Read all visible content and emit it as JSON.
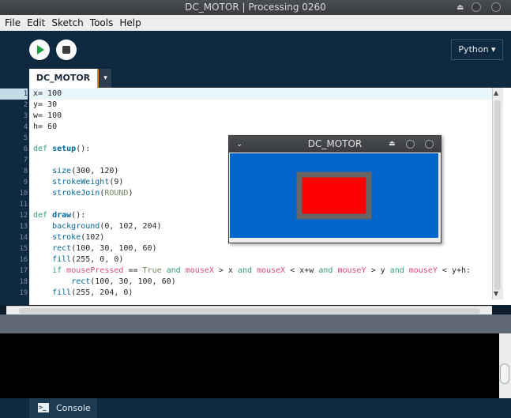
{
  "window": {
    "title": "DC_MOTOR | Processing 0260"
  },
  "menu": [
    "File",
    "Edit",
    "Sketch",
    "Tools",
    "Help"
  ],
  "toolbar": {
    "mode_label": "Python ▾"
  },
  "tabs": {
    "main": "DC_MOTOR",
    "menu_arrow": "▾"
  },
  "editor": {
    "current_line": 1,
    "lines": [
      {
        "n": "1",
        "html": "x= 100"
      },
      {
        "n": "2",
        "html": "y= 30"
      },
      {
        "n": "3",
        "html": "w= 100"
      },
      {
        "n": "4",
        "html": "h= 60"
      },
      {
        "n": "5",
        "html": ""
      },
      {
        "n": "6",
        "html": "<span class=\"kw\">def</span> <span class=\"fn\">setup</span>():"
      },
      {
        "n": "7",
        "html": ""
      },
      {
        "n": "8",
        "html": "    <span class=\"bi\">size</span>(300, 120)"
      },
      {
        "n": "9",
        "html": "    <span class=\"bi\">strokeWeight</span>(9)"
      },
      {
        "n": "10",
        "html": "    <span class=\"bi\">strokeJoin</span>(<span class=\"con\">ROUND</span>)"
      },
      {
        "n": "11",
        "html": ""
      },
      {
        "n": "12",
        "html": "<span class=\"kw\">def</span> <span class=\"fn\">draw</span>():"
      },
      {
        "n": "13",
        "html": "    <span class=\"bi\">background</span>(0, 102, 204)"
      },
      {
        "n": "14",
        "html": "    <span class=\"bi\">stroke</span>(102)"
      },
      {
        "n": "15",
        "html": "    <span class=\"bi\">rect</span>(100, 30, 100, 60)"
      },
      {
        "n": "16",
        "html": "    <span class=\"bi\">fill</span>(255, 0, 0)"
      },
      {
        "n": "17",
        "html": "    <span class=\"kw\">if</span> <span class=\"pv\">mousePressed</span> == <span class=\"con\">True</span> <span class=\"kw\">and</span> <span class=\"pv\">mouseX</span> &gt; x <span class=\"kw\">and</span> <span class=\"pv\">mouseX</span> &lt; x+w <span class=\"kw\">and</span> <span class=\"pv\">mouseY</span> &gt; y <span class=\"kw\">and</span> <span class=\"pv\">mouseY</span> &lt; y+h:"
      },
      {
        "n": "18",
        "html": "        <span class=\"bi\">rect</span>(100, 30, 100, 60)"
      },
      {
        "n": "19",
        "html": "    <span class=\"bi\">fill</span>(255, 204, 0)"
      }
    ]
  },
  "console": {
    "tab_label": "Console",
    "icon": "terminal-icon"
  },
  "sketch_window": {
    "title": "DC_MOTOR",
    "background": "#0066cc",
    "stroke": "#666666",
    "fill": "#ff0000"
  }
}
